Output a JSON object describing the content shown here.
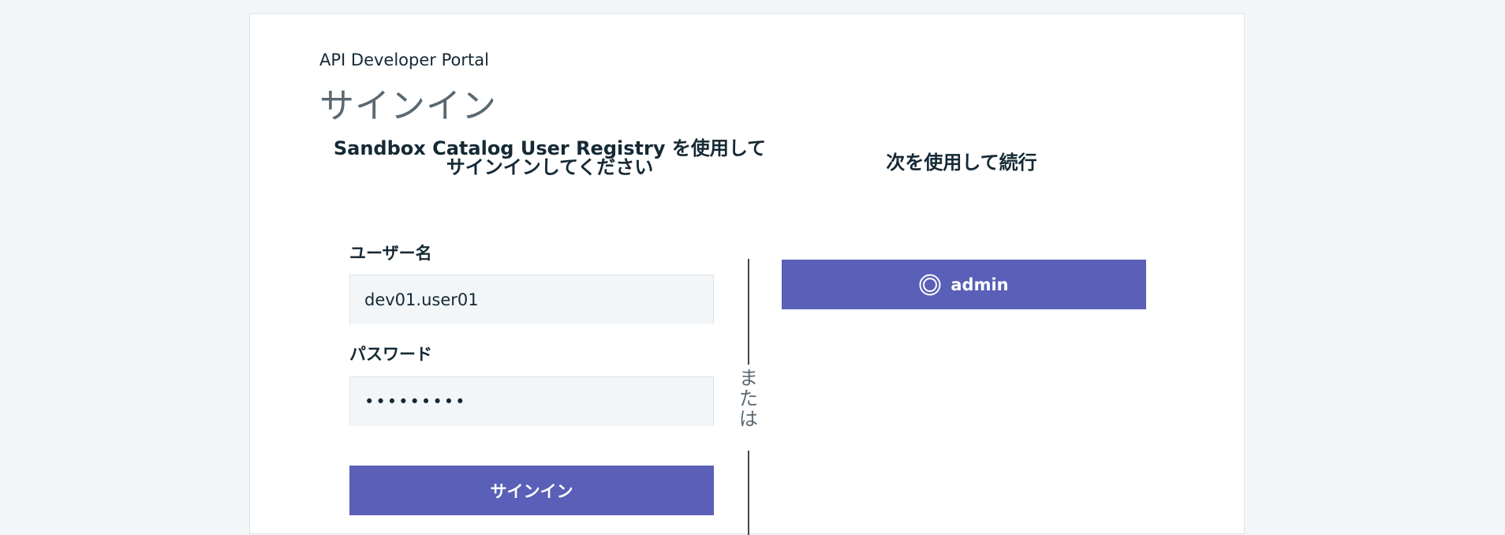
{
  "header": {
    "portal_name": "API Developer Portal",
    "title": "サインイン"
  },
  "local_login": {
    "heading_line1": "Sandbox Catalog User Registry を使用して",
    "heading_line2": "サインインしてください",
    "username_label": "ユーザー名",
    "username_value": "dev01.user01",
    "password_label": "パスワード",
    "password_value": "•••••••••",
    "signin_label": "サインイン"
  },
  "divider": {
    "text": "または"
  },
  "external_login": {
    "heading": "次を使用して続行",
    "provider_label": "admin",
    "provider_icon": "user-circle-icon"
  },
  "colors": {
    "primary": "#5a5fb7",
    "background": "#f3f6f9",
    "text": "#152935",
    "muted_text": "#5a6872"
  }
}
